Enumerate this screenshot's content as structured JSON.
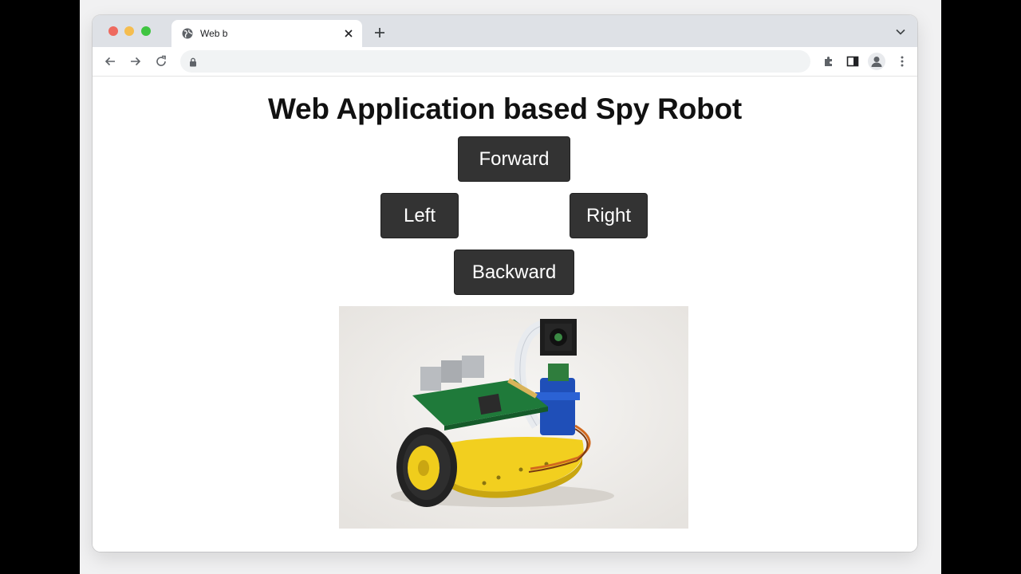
{
  "browser": {
    "tab": {
      "title": "Web b",
      "favicon": "globe-icon",
      "close_icon": "close-icon"
    },
    "new_tab_icon": "plus-icon",
    "tab_menu_icon": "chevron-down-icon",
    "nav": {
      "back_icon": "arrow-left-icon",
      "forward_icon": "arrow-right-icon",
      "reload_icon": "reload-icon"
    },
    "omnibox": {
      "value": "",
      "icon": "lock-icon"
    },
    "toolbar_icons": [
      "puzzle-icon",
      "side-panel-icon",
      "profile-icon",
      "kebab-menu-icon"
    ]
  },
  "page": {
    "title": "Web Application based Spy Robot",
    "controls": {
      "forward": "Forward",
      "left": "Left",
      "right": "Right",
      "backward": "Backward"
    },
    "image": {
      "subject": "robot car with camera"
    }
  },
  "colors": {
    "button_bg": "#333333",
    "button_text": "#ffffff",
    "chassis": "#f2cf1f",
    "servo": "#1f4fb8",
    "pcb": "#1f7a3a"
  }
}
